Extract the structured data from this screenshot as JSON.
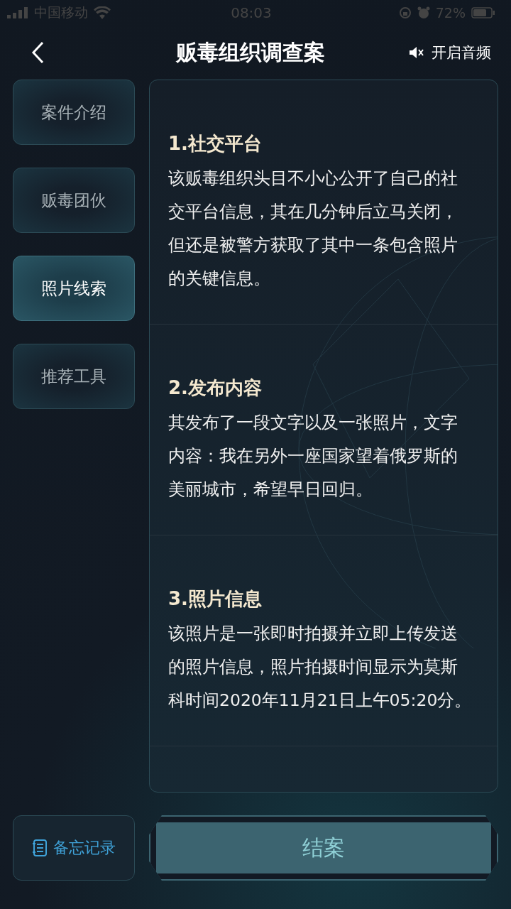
{
  "status_bar": {
    "carrier": "中国移动",
    "time": "08:03",
    "battery": "72%"
  },
  "header": {
    "title": "贩毒组织调查案",
    "audio_label": "开启音频"
  },
  "sidebar": {
    "items": [
      {
        "label": "案件介绍",
        "selected": false
      },
      {
        "label": "贩毒团伙",
        "selected": false
      },
      {
        "label": "照片线索",
        "selected": true
      },
      {
        "label": "推荐工具",
        "selected": false
      }
    ]
  },
  "sections": [
    {
      "heading": "1.社交平台",
      "body": "该贩毒组织头目不小心公开了自己的社交平台信息，其在几分钟后立马关闭，但还是被警方获取了其中一条包含照片的关键信息。"
    },
    {
      "heading": "2.发布内容",
      "body": "其发布了一段文字以及一张照片，文字内容：我在另外一座国家望着俄罗斯的美丽城市，希望早日回归。"
    },
    {
      "heading": "3.照片信息",
      "body": "该照片是一张即时拍摄并立即上传发送的照片信息，照片拍摄时间显示为莫斯科时间2020年11月21日上午05:20分。"
    }
  ],
  "footer": {
    "notes_label": "备忘记录",
    "close_case_label": "结案"
  }
}
